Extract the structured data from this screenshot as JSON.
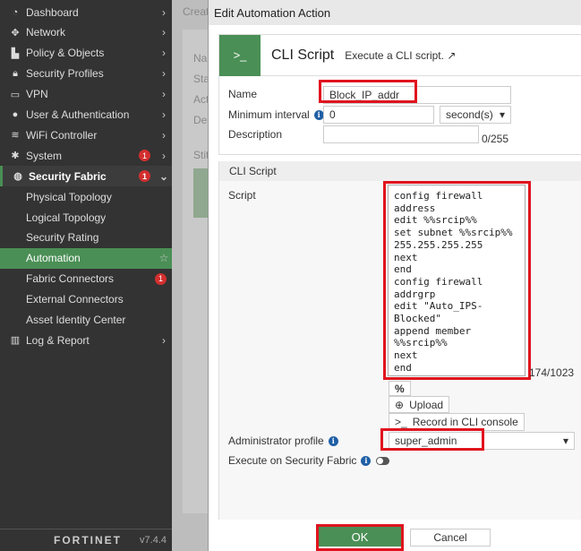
{
  "sidebar": {
    "items": [
      {
        "label": "Dashboard",
        "icon": "dashboard-icon"
      },
      {
        "label": "Network",
        "icon": "network-icon"
      },
      {
        "label": "Policy & Objects",
        "icon": "policy-icon"
      },
      {
        "label": "Security Profiles",
        "icon": "lock-icon"
      },
      {
        "label": "VPN",
        "icon": "laptop-icon"
      },
      {
        "label": "User & Authentication",
        "icon": "user-icon"
      },
      {
        "label": "WiFi Controller",
        "icon": "wifi-icon"
      },
      {
        "label": "System",
        "icon": "gear-icon",
        "badge": "1"
      },
      {
        "label": "Security Fabric",
        "icon": "fabric-icon",
        "badge": "1"
      },
      {
        "label": "Physical Topology"
      },
      {
        "label": "Logical Topology"
      },
      {
        "label": "Security Rating"
      },
      {
        "label": "Automation"
      },
      {
        "label": "Fabric Connectors",
        "badge": "1"
      },
      {
        "label": "External Connectors"
      },
      {
        "label": "Asset Identity Center"
      },
      {
        "label": "Log & Report",
        "icon": "chart-icon"
      }
    ],
    "logo": "FORTINET",
    "version": "v7.4.4"
  },
  "background": {
    "crumb": "Creat",
    "labels": [
      "Na",
      "Sta",
      "Act",
      "Des",
      "Stit"
    ]
  },
  "modal": {
    "title": "Edit Automation Action",
    "card": {
      "icon": ">_",
      "title": "CLI Script",
      "description": "Execute a CLI script."
    },
    "name_label": "Name",
    "name_value": "Block_IP_addr",
    "interval_label": "Minimum interval",
    "interval_value": "0",
    "interval_unit": "second(s)",
    "description_label": "Description",
    "description_value": "",
    "description_count": "0/255",
    "section_title": "CLI Script",
    "script_label": "Script",
    "script": "config firewall address\nedit %%srcip%%\nset subnet %%srcip%% 255.255.255.255\nnext\nend\nconfig firewall addrgrp\nedit \"Auto_IPS-Blocked\"\nappend member %%srcip%%\nnext\nend",
    "script_count": "174/1023",
    "percent_btn": "%",
    "upload_btn": "Upload",
    "record_btn": "Record in CLI console",
    "admin_label": "Administrator profile",
    "admin_value": "super_admin",
    "fabric_label": "Execute on Security Fabric",
    "ok": "OK",
    "cancel": "Cancel"
  }
}
